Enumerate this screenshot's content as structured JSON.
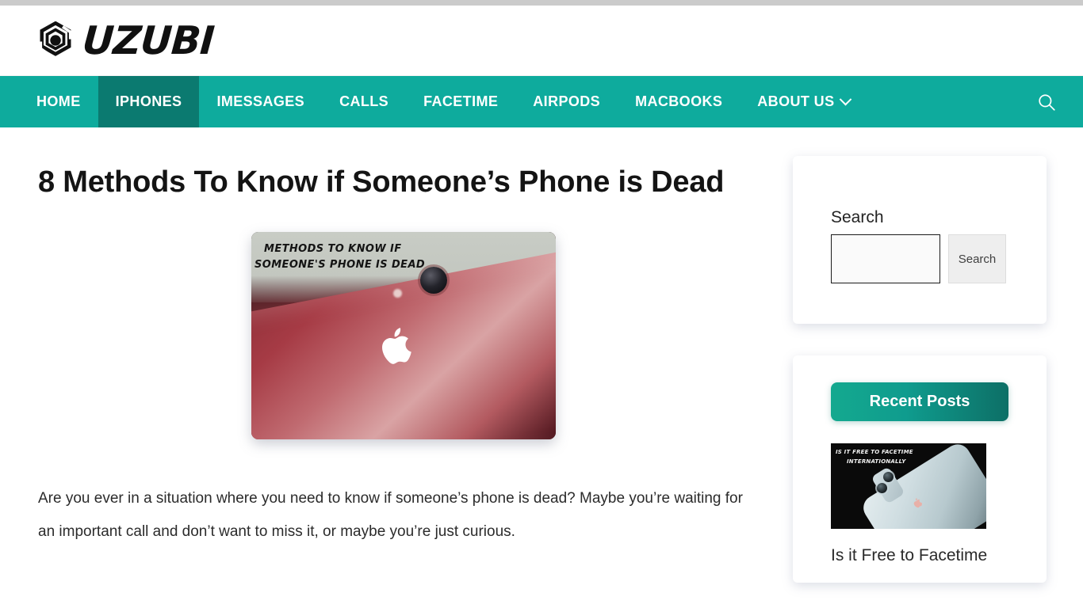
{
  "header": {
    "logo_text": "UZUBI",
    "logo_icon": "hexagon-swirl-logo-icon"
  },
  "nav": {
    "items": [
      {
        "label": "HOME",
        "active": false,
        "has_dropdown": false
      },
      {
        "label": "IPHONES",
        "active": true,
        "has_dropdown": false
      },
      {
        "label": "IMESSAGES",
        "active": false,
        "has_dropdown": false
      },
      {
        "label": "CALLS",
        "active": false,
        "has_dropdown": false
      },
      {
        "label": "FACETIME",
        "active": false,
        "has_dropdown": false
      },
      {
        "label": "AIRPODS",
        "active": false,
        "has_dropdown": false
      },
      {
        "label": "MACBOOKS",
        "active": false,
        "has_dropdown": false
      },
      {
        "label": "ABOUT US",
        "active": false,
        "has_dropdown": true
      }
    ],
    "search_icon": "search-icon",
    "bar_color": "#0eab9d",
    "active_color": "#0b7a70"
  },
  "article": {
    "title": "8 Methods To Know if Someone’s Phone is Dead",
    "featured_image": {
      "caption_line1": "METHODS TO KNOW IF",
      "caption_line2": "SOMEONE'S PHONE IS DEAD",
      "alt": "red iphone with apple logo"
    },
    "paragraph": "Are you ever in a situation where you need to know if someone’s phone is dead? Maybe you’re waiting for an important call and don’t want to miss it, or maybe you’re just curious."
  },
  "sidebar": {
    "search_widget": {
      "label": "Search",
      "input_value": "",
      "input_placeholder": "",
      "button_label": "Search"
    },
    "recent_widget": {
      "heading": "Recent Posts",
      "posts": [
        {
          "title": "Is it Free to Facetime",
          "thumb_caption_line1": "IS IT FREE TO FACETIME",
          "thumb_caption_line2": "INTERNATIONALLY"
        }
      ]
    }
  }
}
